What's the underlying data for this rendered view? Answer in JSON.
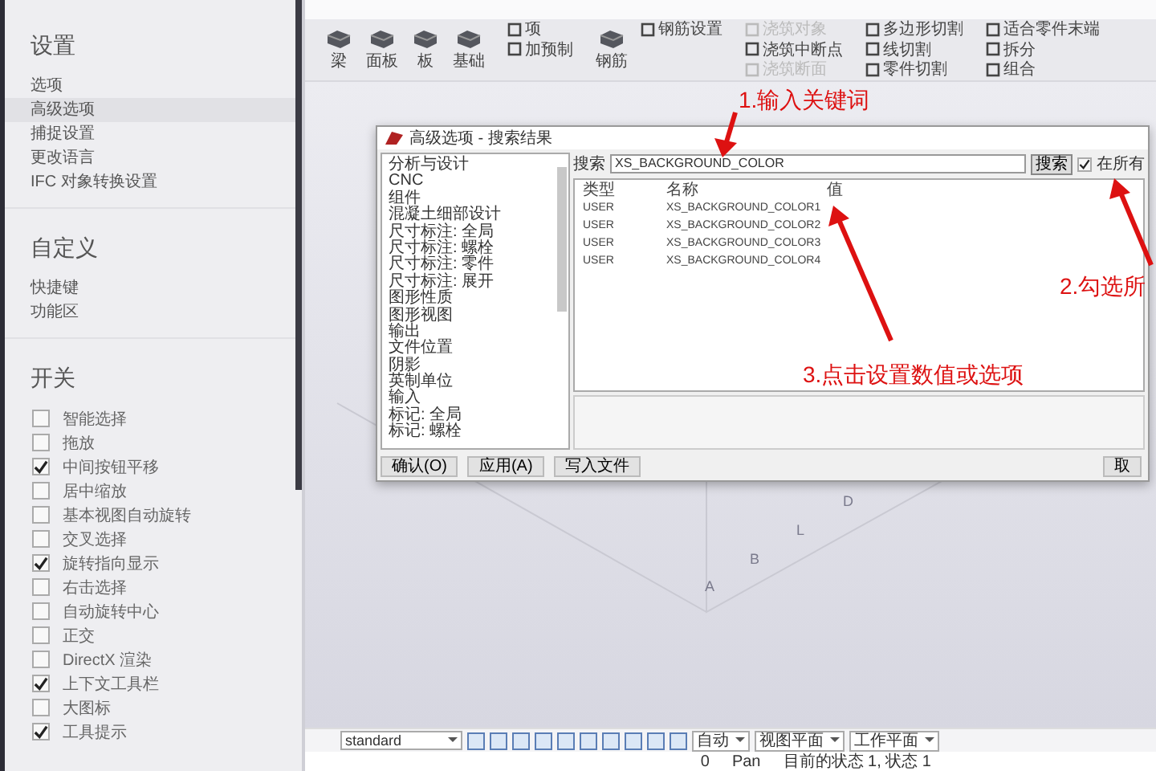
{
  "sidebar": {
    "sections": [
      {
        "title": "设置",
        "items": [
          {
            "label": "选项",
            "selected": false
          },
          {
            "label": "高级选项",
            "selected": true
          },
          {
            "label": "捕捉设置",
            "selected": false
          },
          {
            "label": "更改语言",
            "selected": false
          },
          {
            "label": "IFC 对象转换设置",
            "selected": false
          }
        ]
      },
      {
        "title": "自定义",
        "items": [
          {
            "label": "快捷键",
            "selected": false
          },
          {
            "label": "功能区",
            "selected": false
          }
        ]
      }
    ],
    "toggles": {
      "title": "开关",
      "items": [
        {
          "label": "智能选择",
          "checked": false
        },
        {
          "label": "拖放",
          "checked": false
        },
        {
          "label": "中间按钮平移",
          "checked": true
        },
        {
          "label": "居中缩放",
          "checked": false
        },
        {
          "label": "基本视图自动旋转",
          "checked": false
        },
        {
          "label": "交叉选择",
          "checked": false
        },
        {
          "label": "旋转指向显示",
          "checked": true
        },
        {
          "label": "右击选择",
          "checked": false
        },
        {
          "label": "自动旋转中心",
          "checked": false
        },
        {
          "label": "正交",
          "checked": false
        },
        {
          "label": "DirectX 渲染",
          "checked": false
        },
        {
          "label": "上下文工具栏",
          "checked": true
        },
        {
          "label": "大图标",
          "checked": false
        },
        {
          "label": "工具提示",
          "checked": true
        }
      ]
    }
  },
  "ribbon": {
    "groups": [
      {
        "items": [
          {
            "kind": "large",
            "label": "梁",
            "disabled": false
          },
          {
            "kind": "large",
            "label": "面板",
            "disabled": false
          },
          {
            "kind": "large",
            "label": "板",
            "disabled": false
          },
          {
            "kind": "large",
            "label": "基础",
            "disabled": false
          }
        ]
      },
      {
        "items": [
          {
            "kind": "small",
            "label": "项",
            "disabled": false
          },
          {
            "kind": "small",
            "label": "加预制",
            "disabled": false
          }
        ]
      },
      {
        "items": [
          {
            "kind": "large",
            "label": "钢筋",
            "disabled": false
          },
          {
            "kind": "small",
            "label": "钢筋设置",
            "disabled": false
          }
        ]
      },
      {
        "items": [
          {
            "kind": "small",
            "label": "浇筑对象",
            "disabled": true
          },
          {
            "kind": "small",
            "label": "浇筑中断点",
            "disabled": false
          },
          {
            "kind": "small",
            "label": "浇筑断面",
            "disabled": true
          }
        ]
      },
      {
        "items": [
          {
            "kind": "small",
            "label": "多边形切割",
            "disabled": false
          },
          {
            "kind": "small",
            "label": "线切割",
            "disabled": false
          },
          {
            "kind": "small",
            "label": "零件切割",
            "disabled": false
          }
        ]
      },
      {
        "items": [
          {
            "kind": "small",
            "label": "适合零件末端",
            "disabled": false
          },
          {
            "kind": "small",
            "label": "拆分",
            "disabled": false
          },
          {
            "kind": "small",
            "label": "组合",
            "disabled": false
          }
        ]
      }
    ]
  },
  "canvas": {
    "grid_labels": [
      "D",
      "L",
      "B",
      "A"
    ]
  },
  "dialog": {
    "title": "高级选项 - 搜索结果",
    "categories": [
      {
        "label": "分析与设计"
      },
      {
        "label": "CNC"
      },
      {
        "label": "组件"
      },
      {
        "label": "混凝土细部设计"
      },
      {
        "label": "尺寸标注: 全局"
      },
      {
        "label": "尺寸标注: 螺栓"
      },
      {
        "label": "尺寸标注: 零件"
      },
      {
        "label": "尺寸标注: 展开"
      },
      {
        "label": "图形性质"
      },
      {
        "label": "图形视图"
      },
      {
        "label": "输出"
      },
      {
        "label": "文件位置"
      },
      {
        "label": "阴影"
      },
      {
        "label": "英制单位"
      },
      {
        "label": "输入"
      },
      {
        "label": "标记: 全局"
      },
      {
        "label": "标记: 螺栓"
      }
    ],
    "search": {
      "label": "搜索",
      "value": "XS_BACKGROUND_COLOR",
      "button": "搜索",
      "checkbox_label": "在所有",
      "checked": true
    },
    "table": {
      "columns": [
        "类型",
        "名称",
        "值"
      ],
      "rows": [
        [
          "USER",
          "XS_BACKGROUND_COLOR1"
        ],
        [
          "USER",
          "XS_BACKGROUND_COLOR2"
        ],
        [
          "USER",
          "XS_BACKGROUND_COLOR3"
        ],
        [
          "USER",
          "XS_BACKGROUND_COLOR4"
        ]
      ]
    },
    "buttons": [
      "确认(O)",
      "应用(A)",
      "写入文件"
    ],
    "cancel_button": "取"
  },
  "annotations": [
    {
      "text": "1.输入关键词"
    },
    {
      "text": "2.勾选所"
    },
    {
      "text": "3.点击设置数值或选项"
    }
  ],
  "bottom_toolbar": {
    "style_select": "standard",
    "dropdowns": [
      "自动",
      "视图平面",
      "工作平面"
    ]
  },
  "status_bar": {
    "count": "0",
    "mode": "Pan",
    "message": "目前的状态 1, 状态 1"
  }
}
